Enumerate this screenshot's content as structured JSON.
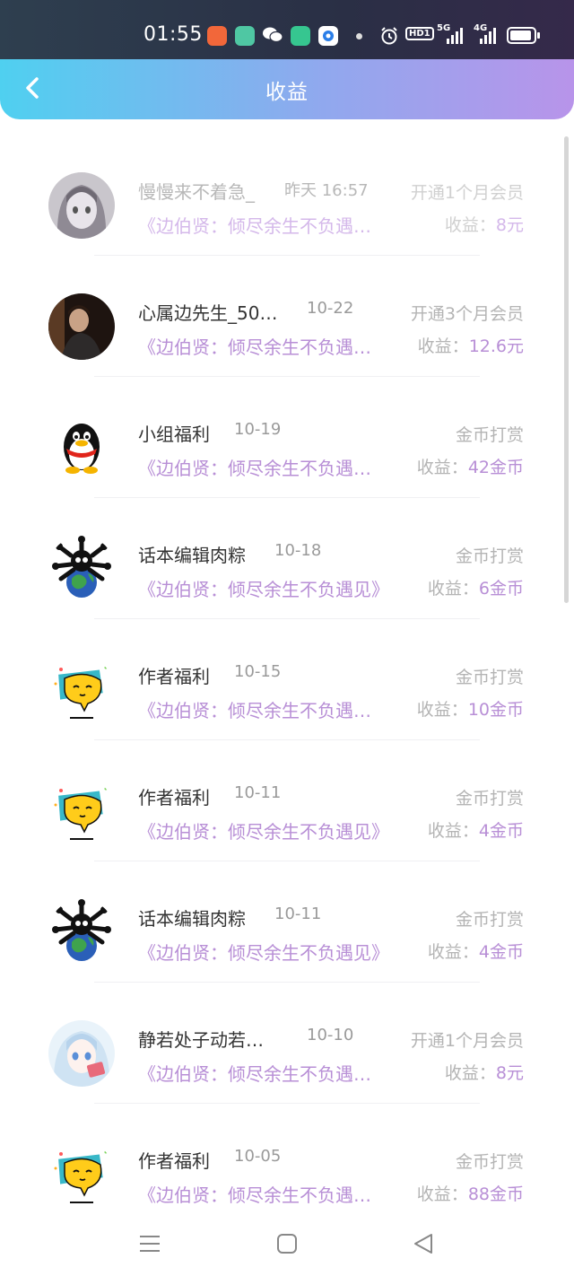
{
  "status_bar": {
    "time": "01:55",
    "network_1": "HD1",
    "network_2": "5G",
    "network_3": "4G",
    "app_icon_colors": [
      "#f2673a",
      "#4fc7a3",
      "#ffffff",
      "#36c690",
      "#2a7ee8"
    ]
  },
  "header": {
    "title": "收益",
    "back_icon": "chevron-left-icon"
  },
  "colors": {
    "accent_purple": "#b88fd6",
    "header_gradient_start": "#4fd0f0",
    "header_gradient_end": "#b894ea"
  },
  "income_label": "收益：",
  "records": [
    {
      "avatar": "anime-girl-gray",
      "name": "慢慢来不着急_",
      "date": "昨天 16:57",
      "type": "开通1个月会员",
      "book": "《边伯贤：倾尽余生不负遇…",
      "income": "8元",
      "faded": true
    },
    {
      "avatar": "dark-portrait",
      "name": "心属边先生_50…",
      "date": "10-22",
      "type": "开通3个月会员",
      "book": "《边伯贤：倾尽余生不负遇…",
      "income": "12.6元",
      "faded": false
    },
    {
      "avatar": "qq-penguin",
      "name": "小组福利",
      "date": "10-19",
      "type": "金币打赏",
      "book": "《边伯贤：倾尽余生不负遇…",
      "income": "42金币",
      "faded": false
    },
    {
      "avatar": "globe-creature",
      "name": "话本编辑肉粽",
      "date": "10-18",
      "type": "金币打赏",
      "book": "《边伯贤：倾尽余生不负遇见》",
      "income": "6金币",
      "faded": false
    },
    {
      "avatar": "yellow-emoji",
      "name": "作者福利",
      "date": "10-15",
      "type": "金币打赏",
      "book": "《边伯贤：倾尽余生不负遇…",
      "income": "10金币",
      "faded": false
    },
    {
      "avatar": "yellow-emoji",
      "name": "作者福利",
      "date": "10-11",
      "type": "金币打赏",
      "book": "《边伯贤：倾尽余生不负遇见》",
      "income": "4金币",
      "faded": false
    },
    {
      "avatar": "globe-creature",
      "name": "话本编辑肉粽",
      "date": "10-11",
      "type": "金币打赏",
      "book": "《边伯贤：倾尽余生不负遇见》",
      "income": "4金币",
      "faded": false
    },
    {
      "avatar": "anime-girl-blue",
      "name": "静若处子动若…",
      "date": "10-10",
      "type": "开通1个月会员",
      "book": "《边伯贤：倾尽余生不负遇…",
      "income": "8元",
      "faded": false
    },
    {
      "avatar": "yellow-emoji",
      "name": "作者福利",
      "date": "10-05",
      "type": "金币打赏",
      "book": "《边伯贤：倾尽余生不负遇…",
      "income": "88金币",
      "faded": false
    }
  ],
  "nav_bar": {
    "menu_icon": "menu-icon",
    "home_icon": "home-square-icon",
    "back_icon": "back-triangle-icon"
  }
}
